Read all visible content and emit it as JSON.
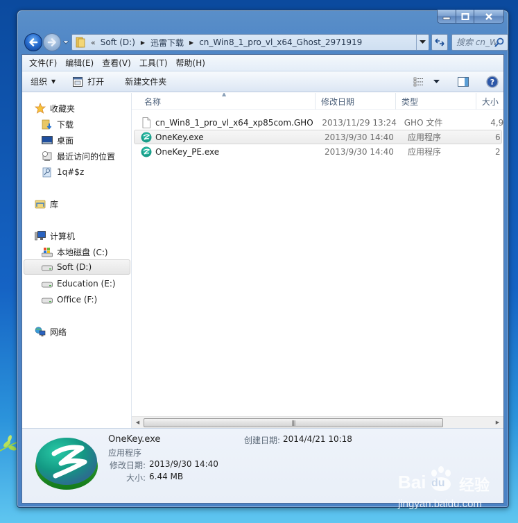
{
  "window": {
    "controls": {
      "minimize": "—",
      "maximize": "☐",
      "close": "✕"
    }
  },
  "nav": {
    "back_label": "Back",
    "forward_label": "Forward",
    "breadcrumb": {
      "overflow": "«",
      "items": [
        "Soft (D:)",
        "迅雷下载",
        "cn_Win8_1_pro_vl_x64_Ghost_2971919"
      ]
    },
    "search_placeholder": "搜索 cn_W..."
  },
  "menubar": {
    "items": [
      "文件(F)",
      "编辑(E)",
      "查看(V)",
      "工具(T)",
      "帮助(H)"
    ]
  },
  "toolbar": {
    "organize_label": "组织",
    "open_label": "打开",
    "new_folder_label": "新建文件夹"
  },
  "sidebar": {
    "favorites": {
      "label": "收藏夹",
      "items": [
        "下载",
        "桌面",
        "最近访问的位置",
        "1q#$z"
      ]
    },
    "libraries": {
      "label": "库"
    },
    "computer": {
      "label": "计算机",
      "items": [
        "本地磁盘 (C:)",
        "Soft (D:)",
        "Education (E:)",
        "Office (F:)"
      ],
      "selected": "Soft (D:)"
    },
    "network": {
      "label": "网络"
    }
  },
  "file_list": {
    "columns": [
      "名称",
      "修改日期",
      "类型",
      "大小"
    ],
    "rows": [
      {
        "name": "cn_Win8_1_pro_vl_x64_xp85com.GHO",
        "date": "2013/11/29 13:24",
        "type": "GHO 文件",
        "size": "4,9",
        "icon": "file-icon",
        "selected": false
      },
      {
        "name": "OneKey.exe",
        "date": "2013/9/30 14:40",
        "type": "应用程序",
        "size": "6",
        "icon": "onekey-app-icon",
        "selected": true
      },
      {
        "name": "OneKey_PE.exe",
        "date": "2013/9/30 14:40",
        "type": "应用程序",
        "size": "2",
        "icon": "onekey-app-icon",
        "selected": false
      }
    ],
    "hscroll_thumb_fraction": 0.86
  },
  "details": {
    "name": "OneKey.exe",
    "type": "应用程序",
    "modified_label": "修改日期:",
    "modified_value": "2013/9/30 14:40",
    "size_label": "大小:",
    "size_value": "6.44 MB",
    "created_label": "创建日期:",
    "created_value": "2014/4/21 10:18"
  },
  "watermark": {
    "brand": "Bai",
    "brand_tail": "du",
    "suffix": "经验",
    "url": "jingyan.baidu.com"
  }
}
